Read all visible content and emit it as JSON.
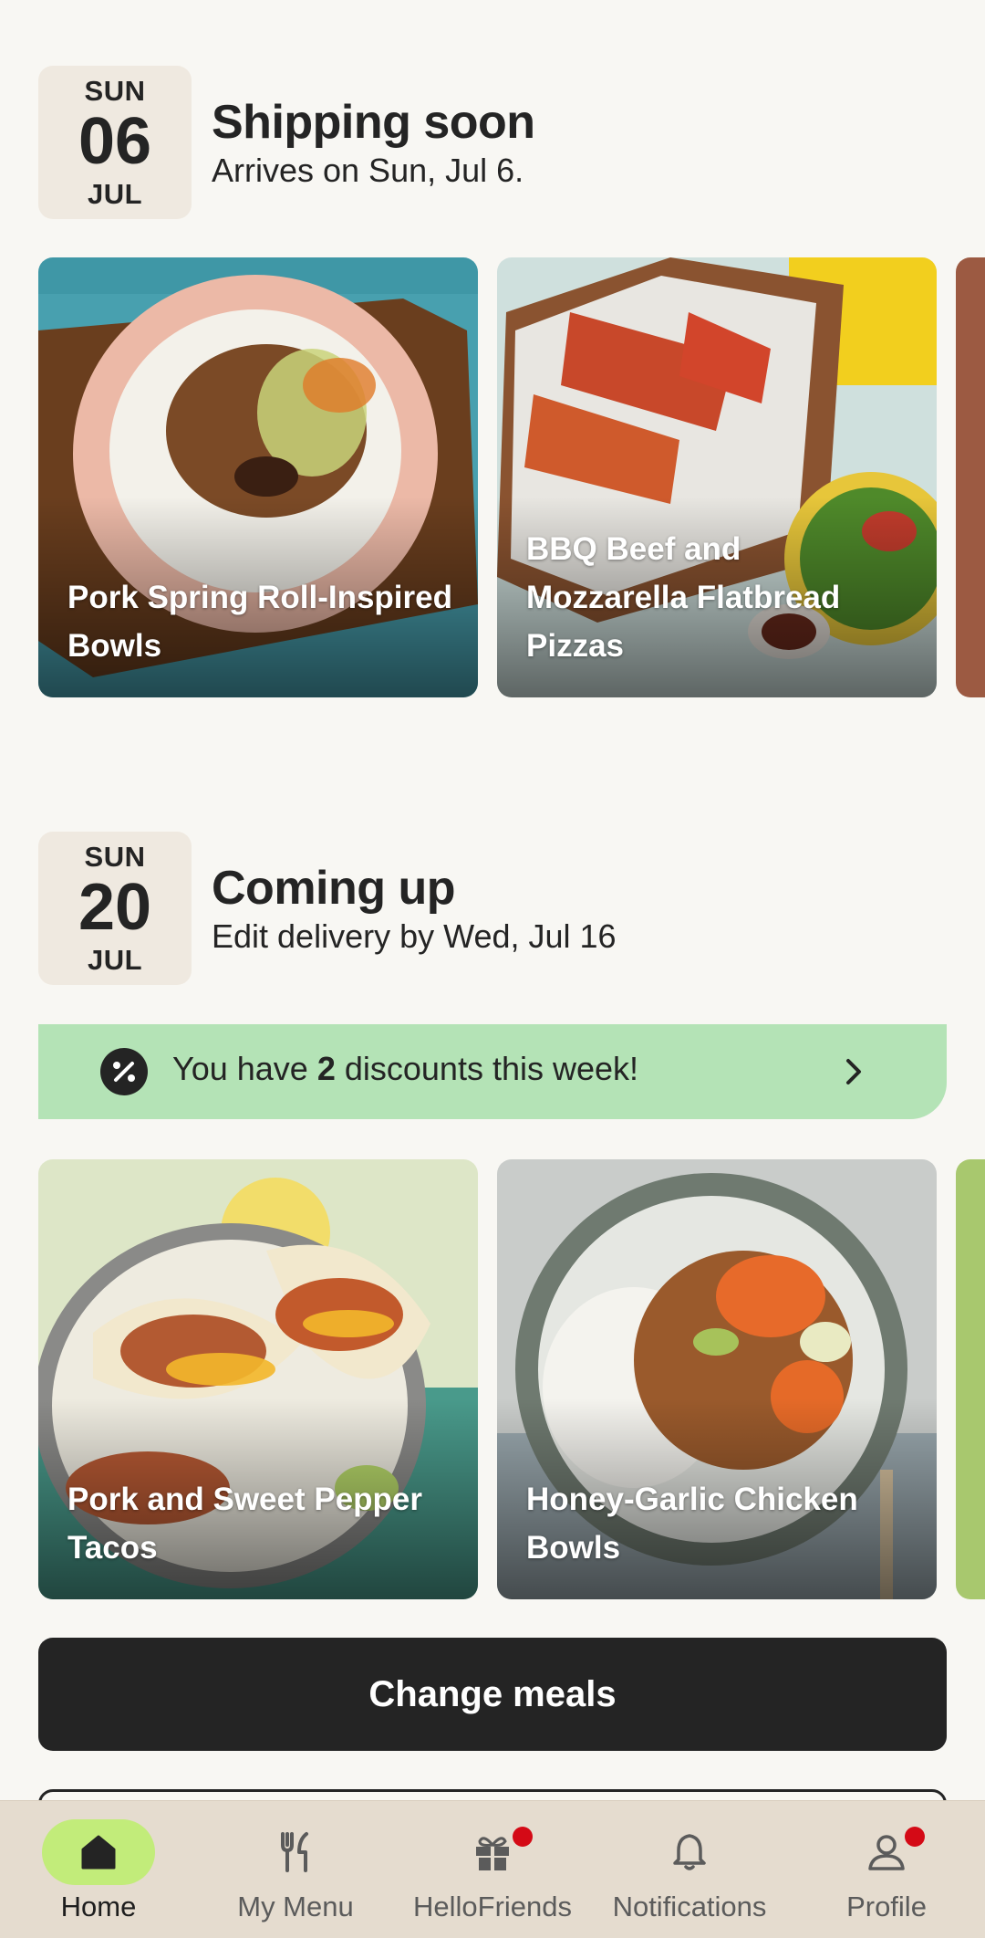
{
  "shipping": {
    "date": {
      "dow": "SUN",
      "day": "06",
      "mon": "JUL"
    },
    "title": "Shipping soon",
    "subtitle": "Arrives on Sun, Jul 6.",
    "meals": [
      {
        "name": "Pork Spring Roll-Inspired Bowls"
      },
      {
        "name": "BBQ Beef and Mozzarella Flatbread Pizzas"
      }
    ]
  },
  "upcoming": {
    "date": {
      "dow": "SUN",
      "day": "20",
      "mon": "JUL"
    },
    "title": "Coming up",
    "subtitle": "Edit delivery by Wed, Jul 16",
    "discount": {
      "prefix": "You have ",
      "count": "2",
      "suffix": " discounts this week!"
    },
    "meals": [
      {
        "name": "Pork and Sweet Pepper Tacos"
      },
      {
        "name": "Honey-Garlic Chicken Bowls"
      }
    ],
    "change_meals_label": "Change meals"
  },
  "nav": {
    "items": [
      {
        "label": "Home",
        "icon": "home-icon",
        "active": true
      },
      {
        "label": "My Menu",
        "icon": "fork-knife-icon"
      },
      {
        "label": "HelloFriends",
        "icon": "gift-icon",
        "badge": true
      },
      {
        "label": "Notifications",
        "icon": "bell-icon"
      },
      {
        "label": "Profile",
        "icon": "person-icon",
        "badge": true
      }
    ]
  },
  "colors": {
    "background": "#f8f7f3",
    "date_badge": "#efe9e0",
    "discount_banner": "#b4e3b6",
    "cta": "#242424",
    "nav_bar": "#e5dccf",
    "nav_active_pill": "#c2ec7a",
    "badge_dot": "#d40a16"
  }
}
